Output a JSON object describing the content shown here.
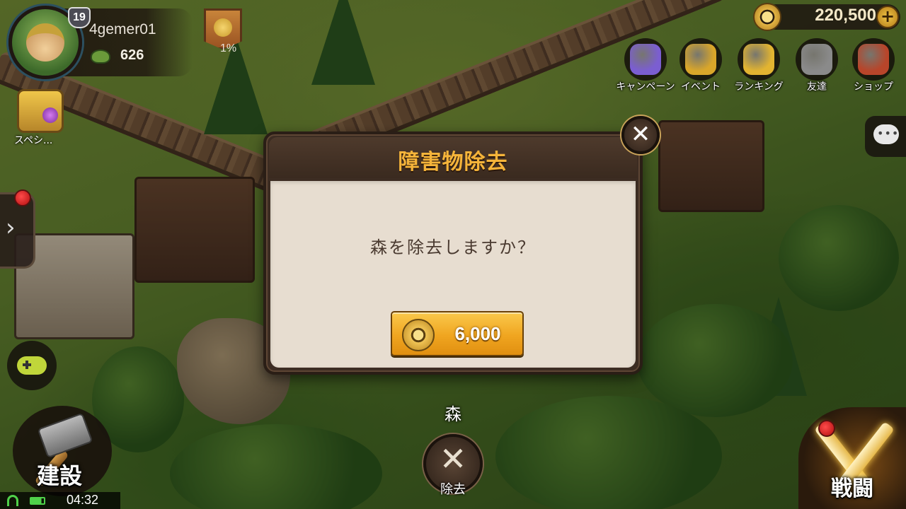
{
  "hud": {
    "player_name": "4gemer01",
    "level": "19",
    "trophies": "626",
    "banner_progress": "1%",
    "special_label": "スペシ...",
    "coins": "220,500",
    "coin_plus": "+"
  },
  "menu": [
    {
      "label": "キャンペーン",
      "icon": "gift-icon",
      "color": "#7b5ed1"
    },
    {
      "label": "イベント",
      "icon": "megaphone-icon",
      "color": "#d9a62a"
    },
    {
      "label": "ランキング",
      "icon": "trophy-icon",
      "color": "#e2b431"
    },
    {
      "label": "友達",
      "icon": "helmet-icon",
      "color": "#8a8a8a"
    },
    {
      "label": "ショップ",
      "icon": "treasure-chest-icon",
      "color": "#b8452a"
    }
  ],
  "dialog": {
    "title": "障害物除去",
    "message": "森を除去しますか？",
    "cost": "6,000",
    "close_symbol": "✕"
  },
  "bottom": {
    "selected_object": "森",
    "remove_symbol": "✕",
    "remove_label": "除去",
    "build_label": "建設",
    "battle_label": "戦闘"
  },
  "status": {
    "time": "04:32"
  },
  "colors": {
    "title_gold": "#f5b43a",
    "button_gold": "#f0a520",
    "dialog_frame": "#3c2c22",
    "dialog_body": "#e7ddd0"
  }
}
